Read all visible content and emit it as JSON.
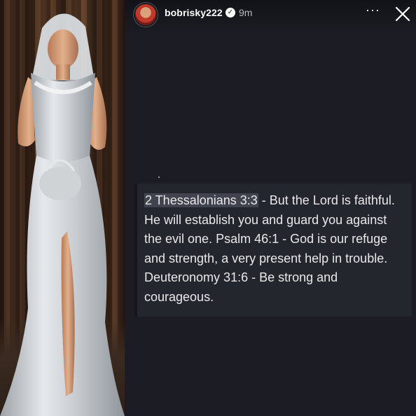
{
  "story": {
    "username": "bobrisky222",
    "time": "9m",
    "more_label": "···",
    "verified_icon": "verified-badge-icon",
    "close_icon": "close-icon",
    "verse": {
      "highlight": "2 Thessalonians 3:3",
      "text": " - But the Lord is faithful. He will establish you and guard you against the evil one. Psalm 46:1 - God is our refuge and strength, a very present help in trouble. Deuteronomy 31:6 - Be strong and courageous."
    }
  },
  "colors": {
    "story_bg": "#1c1d24",
    "card_bg": "#24262d",
    "highlight_bg": "#41444e",
    "text": "#e9e9ec"
  }
}
